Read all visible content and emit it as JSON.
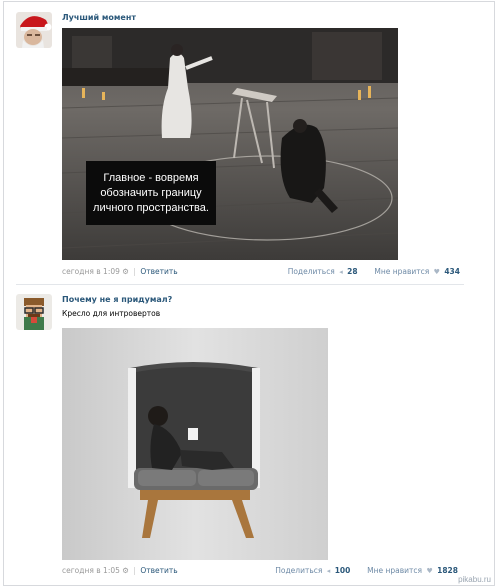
{
  "posts": [
    {
      "author": "Лучший момент",
      "text": "",
      "image_caption": "Главное - вовремя обозначить границу личного пространства.",
      "time": "сегодня в 1:09",
      "reply_label": "Ответить",
      "share_label": "Поделиться",
      "share_count": "28",
      "like_label": "Мне нравится",
      "like_count": "434"
    },
    {
      "author": "Почему не я придумал?",
      "text": "Кресло для интровертов",
      "time": "сегодня в 1:05",
      "reply_label": "Ответить",
      "share_label": "Поделиться",
      "share_count": "100",
      "like_label": "Мне нравится",
      "like_count": "1828"
    }
  ],
  "watermark": "pikabu.ru",
  "colors": {
    "author": "#2b587a",
    "meta": "#999999",
    "divider": "#e3e6ea"
  },
  "icons": [
    "share-icon",
    "heart-icon",
    "settings-icon"
  ]
}
